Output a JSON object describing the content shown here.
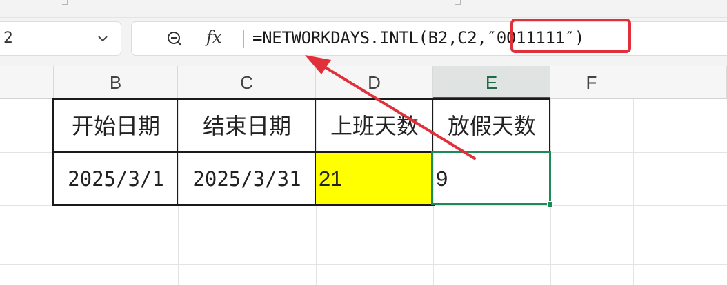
{
  "name_box": {
    "value": "2"
  },
  "formula_bar": {
    "formula_prefix": "=NETWORKDAYS.INTL(B2,C2,",
    "formula_highlight": "″0011111″)",
    "fx_label": "fx"
  },
  "columns": [
    "B",
    "C",
    "D",
    "E",
    "F"
  ],
  "selected_column": "E",
  "table": {
    "headers": [
      "开始日期",
      "结束日期",
      "上班天数",
      "放假天数"
    ],
    "row": [
      "2025/3/1",
      "2025/3/31",
      "21",
      "9"
    ]
  },
  "colors": {
    "highlight_fill": "#ffff00",
    "annotation_red": "#e2303a",
    "selection_green": "#1e8a56"
  },
  "icons": [
    "chevron-down-icon",
    "zoom-out-icon",
    "fx-icon",
    "red-arrow-annotation"
  ]
}
